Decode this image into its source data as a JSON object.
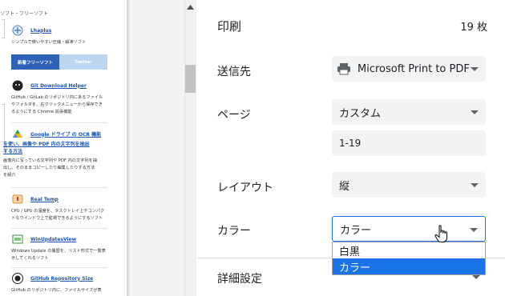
{
  "preview": {
    "category": "ソフト・フリーソフト",
    "items": [
      {
        "title": "Lhaplus",
        "desc": [
          "シンプルで使いやすい圧縮・解凍ソフト"
        ],
        "icon": "lhaplus-icon",
        "color": "#4d7fc7"
      },
      {
        "title": "Git Download Helper",
        "desc": [
          "GitHub / GitLab のリポジトリ内にあるファイル",
          "やフォルダを、右クリックメニューから保存でき",
          "るようにする Chrome 拡張機能"
        ],
        "icon": "octocat-icon",
        "color": "#222222"
      },
      {
        "title": "Google ドライブ の OCR 機能",
        "title2": "を使い、画像や PDF 内の文字列を抽出",
        "title3": "する方法",
        "desc": [
          "画像内に写っている文字列や PDF 内の文字列を抽",
          "出し、そのままコピーしたり編集したりする方法",
          "を紹介"
        ],
        "icon": "google-drive-icon",
        "color": "#f3b400"
      },
      {
        "title": "Real Temp",
        "desc": [
          "CPU / GPU の温度を、タスクトレイ上やコンパク",
          "トなウインドウ上で監視できるようにするソフト"
        ],
        "icon": "thermometer-icon",
        "color": "#d98a2b"
      },
      {
        "title": "WinUpdatesView",
        "desc": [
          "Windows Update の履歴を、リスト形式で一覧表",
          "示してくれるソフト"
        ],
        "icon": "winupdates-icon",
        "color": "#3a8f3a"
      },
      {
        "title": "GitHub Repository Size",
        "desc": [
          "GitHub のリポジトリ内に、ファイルサイズが表"
        ],
        "icon": "github-icon",
        "color": "#222222"
      }
    ],
    "tabs": {
      "active": "新着フリーソフト",
      "inactive": "Twitter"
    }
  },
  "panel": {
    "print_label": "印刷",
    "sheet_count": "19 枚",
    "destination_label": "送信先",
    "destination_value": "Microsoft Print to PDF",
    "pages_label": "ページ",
    "pages_value": "カスタム",
    "pages_range": "1-19",
    "layout_label": "レイアウト",
    "layout_value": "縦",
    "color_label": "カラー",
    "color_value": "カラー",
    "color_options": [
      "白黒",
      "カラー"
    ],
    "color_selected_index": 1,
    "more_settings_label": "詳細設定"
  },
  "colors": {
    "accent": "#1a73e8",
    "field_bg": "#f1f3f4",
    "text": "#202124"
  }
}
